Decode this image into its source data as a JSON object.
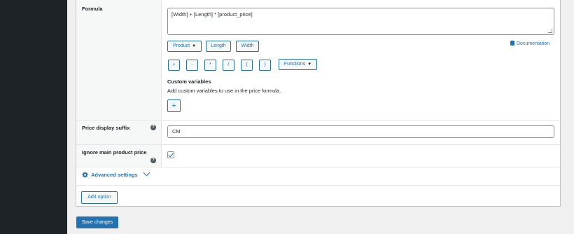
{
  "formula": {
    "label": "Formula",
    "value": "[Width] + [Length] * [product_price]",
    "buttons": [
      {
        "label": "Product",
        "has_dropdown": true
      },
      {
        "label": "Length"
      },
      {
        "label": "Width"
      }
    ],
    "documentation_label": "Documentation",
    "operators": [
      "+",
      "-",
      "*",
      "/",
      "(",
      ")"
    ],
    "functions_label": "Functions",
    "custom_variables_title": "Custom variables",
    "custom_variables_desc": "Add custom variables to use in the price formula.",
    "add_variable_label": "+"
  },
  "price_display_suffix": {
    "label": "Price display suffix",
    "help_icon": "?",
    "value": "CM"
  },
  "ignore_main_price": {
    "label": "Ignore main product price",
    "help_icon": "?",
    "checked": true
  },
  "advanced_settings": {
    "label": "Advanced settings",
    "icon": "gear-icon"
  },
  "add_option_label": "Add option",
  "save_label": "Save changes",
  "colors": {
    "accent": "#2271b1",
    "sidebar": "#1d2327",
    "background": "#f0f0f1"
  }
}
